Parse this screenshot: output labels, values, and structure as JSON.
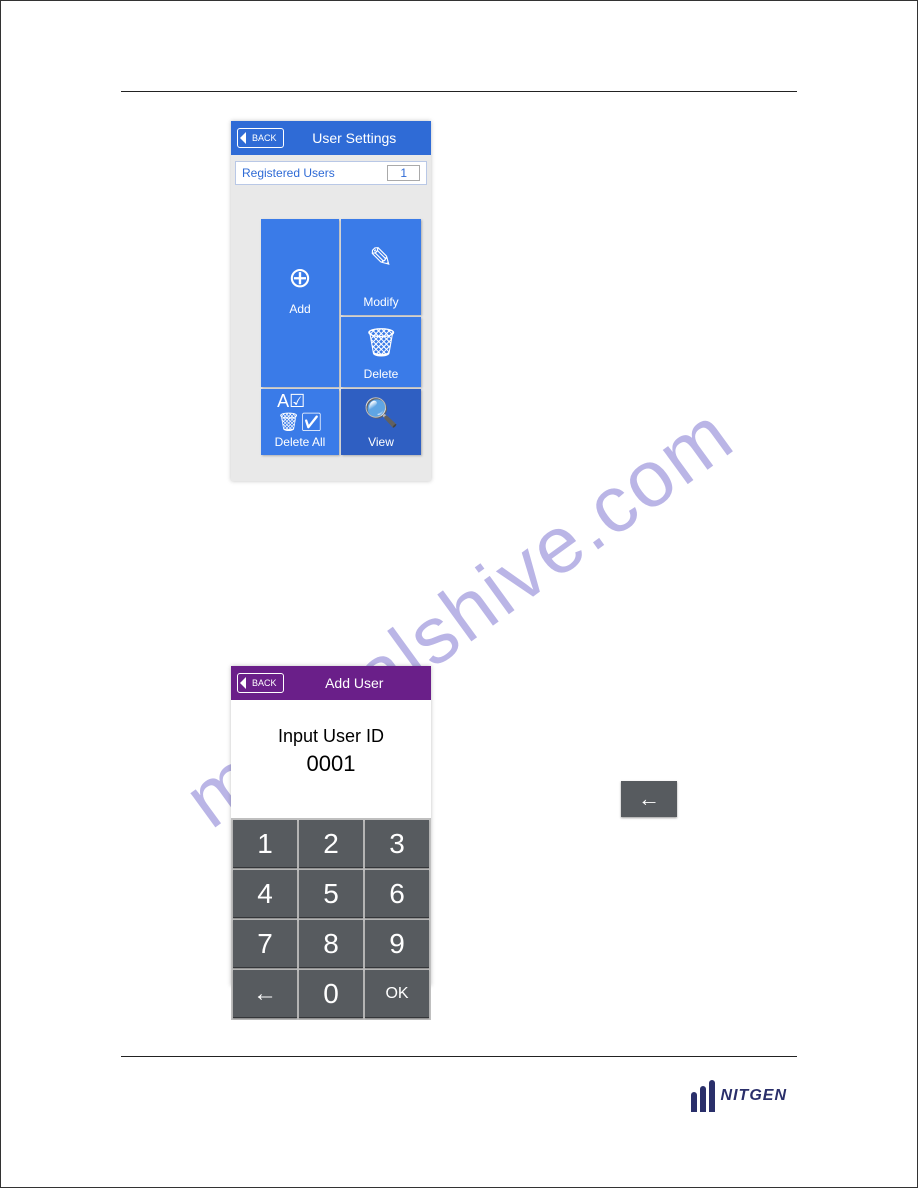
{
  "watermark": "manualshive.com",
  "brand": "NITGEN",
  "screen1": {
    "back": "BACK",
    "title": "User Settings",
    "registered_label": "Registered Users",
    "registered_count": "1",
    "tiles": {
      "add": "Add",
      "modify": "Modify",
      "delete": "Delete",
      "delete_all": "Delete All",
      "view": "View"
    }
  },
  "screen2": {
    "back": "BACK",
    "title": "Add User",
    "prompt": "Input User ID",
    "value": "0001",
    "keys": [
      "1",
      "2",
      "3",
      "4",
      "5",
      "6",
      "7",
      "8",
      "9",
      "←",
      "0",
      "OK"
    ]
  },
  "side_arrow": "←"
}
